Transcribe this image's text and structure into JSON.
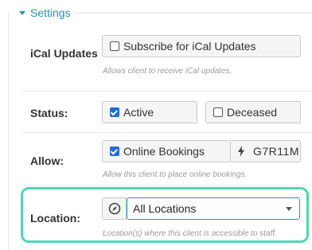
{
  "legend": {
    "label": "Settings"
  },
  "ical": {
    "label": "iCal Updates",
    "checkbox_label": "Subscribe for iCal Updates",
    "checked": false,
    "help": "Allows client to receive iCal updates."
  },
  "status": {
    "label": "Status:",
    "active_label": "Active",
    "active_checked": true,
    "deceased_label": "Deceased",
    "deceased_checked": false
  },
  "allow": {
    "label": "Allow:",
    "online_bookings_label": "Online Bookings",
    "online_bookings_checked": true,
    "code_icon": "bolt-icon",
    "code": "G7R11M",
    "help": "Allow this client to place online bookings."
  },
  "location": {
    "label": "Location:",
    "icon": "compass-icon",
    "selected": "All Locations",
    "help": "Location(s) where this client is accessible to staff."
  },
  "colors": {
    "accent": "#2a8fbd",
    "highlight": "#4fd6b2",
    "checkbox_checked": "#1f6fd1"
  }
}
